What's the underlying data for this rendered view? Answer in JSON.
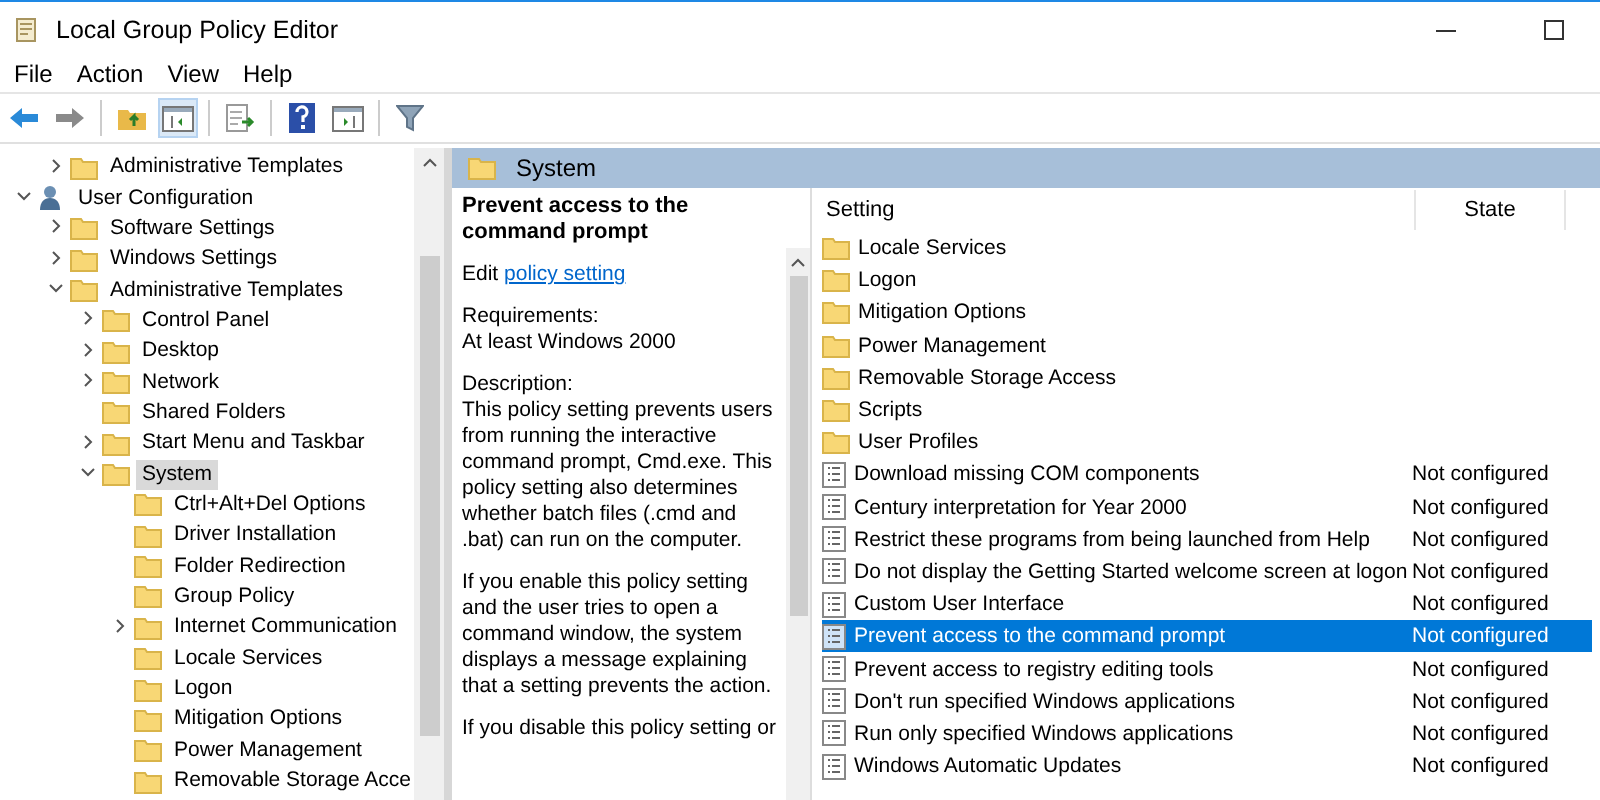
{
  "window": {
    "title": "Local Group Policy Editor"
  },
  "menu": [
    "File",
    "Action",
    "View",
    "Help"
  ],
  "toolbar": [
    {
      "kind": "back"
    },
    {
      "kind": "forward"
    },
    {
      "kind": "up"
    },
    {
      "kind": "tree"
    },
    {
      "kind": "export"
    },
    {
      "kind": "help"
    },
    {
      "kind": "pane"
    },
    {
      "kind": "filter"
    }
  ],
  "tree": [
    {
      "label": "Administrative Templates",
      "kind": "folder",
      "expanded": false,
      "selected": false
    },
    {
      "label": "User Configuration",
      "kind": "user",
      "expanded": true,
      "selected": false,
      "children": [
        {
          "label": "Software Settings",
          "kind": "folder",
          "expanded": false,
          "selected": false
        },
        {
          "label": "Windows Settings",
          "kind": "folder",
          "expanded": false,
          "selected": false
        },
        {
          "label": "Administrative Templates",
          "kind": "folder",
          "expanded": true,
          "selected": false,
          "children": [
            {
              "label": "Control Panel",
              "kind": "folder",
              "expanded": false,
              "selected": false
            },
            {
              "label": "Desktop",
              "kind": "folder",
              "expanded": false,
              "selected": false
            },
            {
              "label": "Network",
              "kind": "folder",
              "expanded": false,
              "selected": false
            },
            {
              "label": "Shared Folders",
              "kind": "folder",
              "selected": false
            },
            {
              "label": "Start Menu and Taskbar",
              "kind": "folder",
              "expanded": false,
              "selected": false
            },
            {
              "label": "System",
              "kind": "folder",
              "expanded": true,
              "selected": true,
              "children": [
                {
                  "label": "Ctrl+Alt+Del Options",
                  "kind": "folder",
                  "selected": false
                },
                {
                  "label": "Driver Installation",
                  "kind": "folder",
                  "selected": false
                },
                {
                  "label": "Folder Redirection",
                  "kind": "folder",
                  "selected": false
                },
                {
                  "label": "Group Policy",
                  "kind": "folder",
                  "selected": false
                },
                {
                  "label": "Internet Communication",
                  "kind": "folder",
                  "expanded": false,
                  "selected": false
                },
                {
                  "label": "Locale Services",
                  "kind": "folder",
                  "selected": false
                },
                {
                  "label": "Logon",
                  "kind": "folder",
                  "selected": false
                },
                {
                  "label": "Mitigation Options",
                  "kind": "folder",
                  "selected": false
                },
                {
                  "label": "Power Management",
                  "kind": "folder",
                  "selected": false
                },
                {
                  "label": "Removable Storage Acce",
                  "kind": "folder",
                  "selected": false
                }
              ]
            }
          ]
        }
      ]
    }
  ],
  "content": {
    "title": "System",
    "description": {
      "heading": "Prevent access to the command prompt",
      "edit_label": "Edit",
      "edit_link": "policy setting",
      "requirements_label": "Requirements:",
      "requirements_value": "At least Windows 2000",
      "description_label": "Description:",
      "paragraphs": [
        "This policy setting prevents users from running the interactive command prompt, Cmd.exe.  This policy setting also determines whether batch files (.cmd and .bat) can run on the computer.",
        "If you enable this policy setting and the user tries to open a command window, the system displays a message explaining that a setting prevents the action.",
        "If you disable this policy setting or"
      ]
    },
    "table": {
      "columns": [
        "Setting",
        "State"
      ],
      "rows": [
        {
          "kind": "folder",
          "name": "Locale Services",
          "selected": false
        },
        {
          "kind": "folder",
          "name": "Logon",
          "selected": false
        },
        {
          "kind": "folder",
          "name": "Mitigation Options",
          "selected": false
        },
        {
          "kind": "folder",
          "name": "Power Management",
          "selected": false
        },
        {
          "kind": "folder",
          "name": "Removable Storage Access",
          "selected": false
        },
        {
          "kind": "folder",
          "name": "Scripts",
          "selected": false
        },
        {
          "kind": "folder",
          "name": "User Profiles",
          "selected": false
        },
        {
          "kind": "policy",
          "name": "Download missing COM components",
          "state": "Not configured",
          "selected": false
        },
        {
          "kind": "policy",
          "name": "Century interpretation for Year 2000",
          "state": "Not configured",
          "selected": false
        },
        {
          "kind": "policy",
          "name": "Restrict these programs from being launched from Help",
          "state": "Not configured",
          "selected": false
        },
        {
          "kind": "policy",
          "name": "Do not display the Getting Started welcome screen at logon",
          "state": "Not configured",
          "selected": false
        },
        {
          "kind": "policy",
          "name": "Custom User Interface",
          "state": "Not configured",
          "selected": false
        },
        {
          "kind": "policy",
          "name": "Prevent access to the command prompt",
          "state": "Not configured",
          "selected": true
        },
        {
          "kind": "policy",
          "name": "Prevent access to registry editing tools",
          "state": "Not configured",
          "selected": false
        },
        {
          "kind": "policy",
          "name": "Don't run specified Windows applications",
          "state": "Not configured",
          "selected": false
        },
        {
          "kind": "policy",
          "name": "Run only specified Windows applications",
          "state": "Not configured",
          "selected": false
        },
        {
          "kind": "policy",
          "name": "Windows Automatic Updates",
          "state": "Not configured",
          "selected": false
        }
      ]
    }
  }
}
